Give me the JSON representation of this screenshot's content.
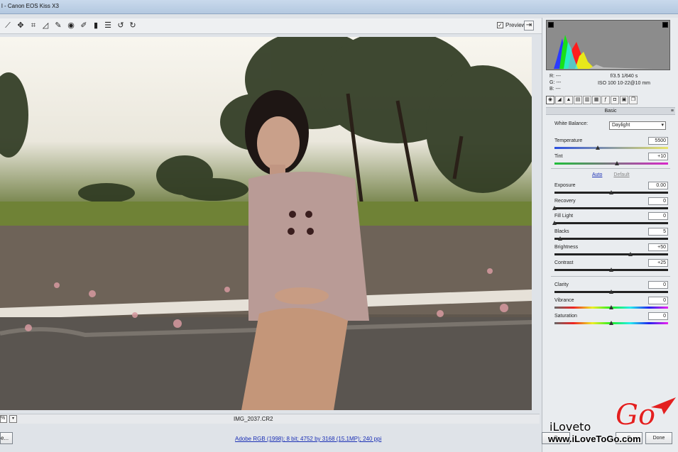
{
  "window": {
    "title": "l - Canon EOS Kiss X3"
  },
  "toolbar": {
    "tools": [
      {
        "name": "zoom-tool-icon",
        "glyph": "⟋"
      },
      {
        "name": "hand-tool-icon",
        "glyph": "✥"
      },
      {
        "name": "crop-tool-icon",
        "glyph": "⌗"
      },
      {
        "name": "straighten-tool-icon",
        "glyph": "◿"
      },
      {
        "name": "spot-removal-icon",
        "glyph": "✎"
      },
      {
        "name": "red-eye-icon",
        "glyph": "◉"
      },
      {
        "name": "adjustment-brush-icon",
        "glyph": "✐"
      },
      {
        "name": "graduated-filter-icon",
        "glyph": "▮"
      },
      {
        "name": "preferences-icon",
        "glyph": "☰"
      },
      {
        "name": "rotate-left-icon",
        "glyph": "↺"
      },
      {
        "name": "rotate-right-icon",
        "glyph": "↻"
      }
    ],
    "preview_label": "Preview",
    "preview_checked": "✓"
  },
  "status": {
    "filename": "IMG_2037.CR2",
    "workflow": "Adobe RGB (1998); 8 bit; 4752 by 3168 (15.1MP); 240 ppi",
    "zoom": "%",
    "save_label": "e..."
  },
  "readout": {
    "r": "R:  ---",
    "g": "G:  ---",
    "b": "B:  ---",
    "exposure_line": "f/3.5   1/640 s",
    "iso_line": "ISO 100   10-22@10 mm"
  },
  "panel": {
    "section_title": "Basic",
    "white_balance_label": "White Balance:",
    "white_balance_value": "Daylight",
    "auto_label": "Auto",
    "default_label": "Default",
    "sliders": [
      {
        "label": "Temperature",
        "value": "5500",
        "pos": 0.38
      },
      {
        "label": "Tint",
        "value": "+10",
        "pos": 0.55
      },
      {
        "label": "Exposure",
        "value": "0.00",
        "pos": 0.5
      },
      {
        "label": "Recovery",
        "value": "0",
        "pos": 0.0
      },
      {
        "label": "Fill Light",
        "value": "0",
        "pos": 0.0
      },
      {
        "label": "Blacks",
        "value": "5",
        "pos": 0.05
      },
      {
        "label": "Brightness",
        "value": "+50",
        "pos": 0.67
      },
      {
        "label": "Contrast",
        "value": "+25",
        "pos": 0.5
      },
      {
        "label": "Clarity",
        "value": "0",
        "pos": 0.5
      },
      {
        "label": "Vibrance",
        "value": "0",
        "pos": 0.5
      },
      {
        "label": "Saturation",
        "value": "0",
        "pos": 0.5
      }
    ]
  },
  "buttons": {
    "open_label": "O",
    "cancel_label": "C",
    "done_label": "Done"
  },
  "watermark": {
    "brand_left": "iLoveto",
    "brand_right": "Go",
    "url": "www.iLoveToGo.com"
  },
  "colors": {
    "accent_link": "#1a2fb5",
    "watermark_red": "#e32020"
  }
}
